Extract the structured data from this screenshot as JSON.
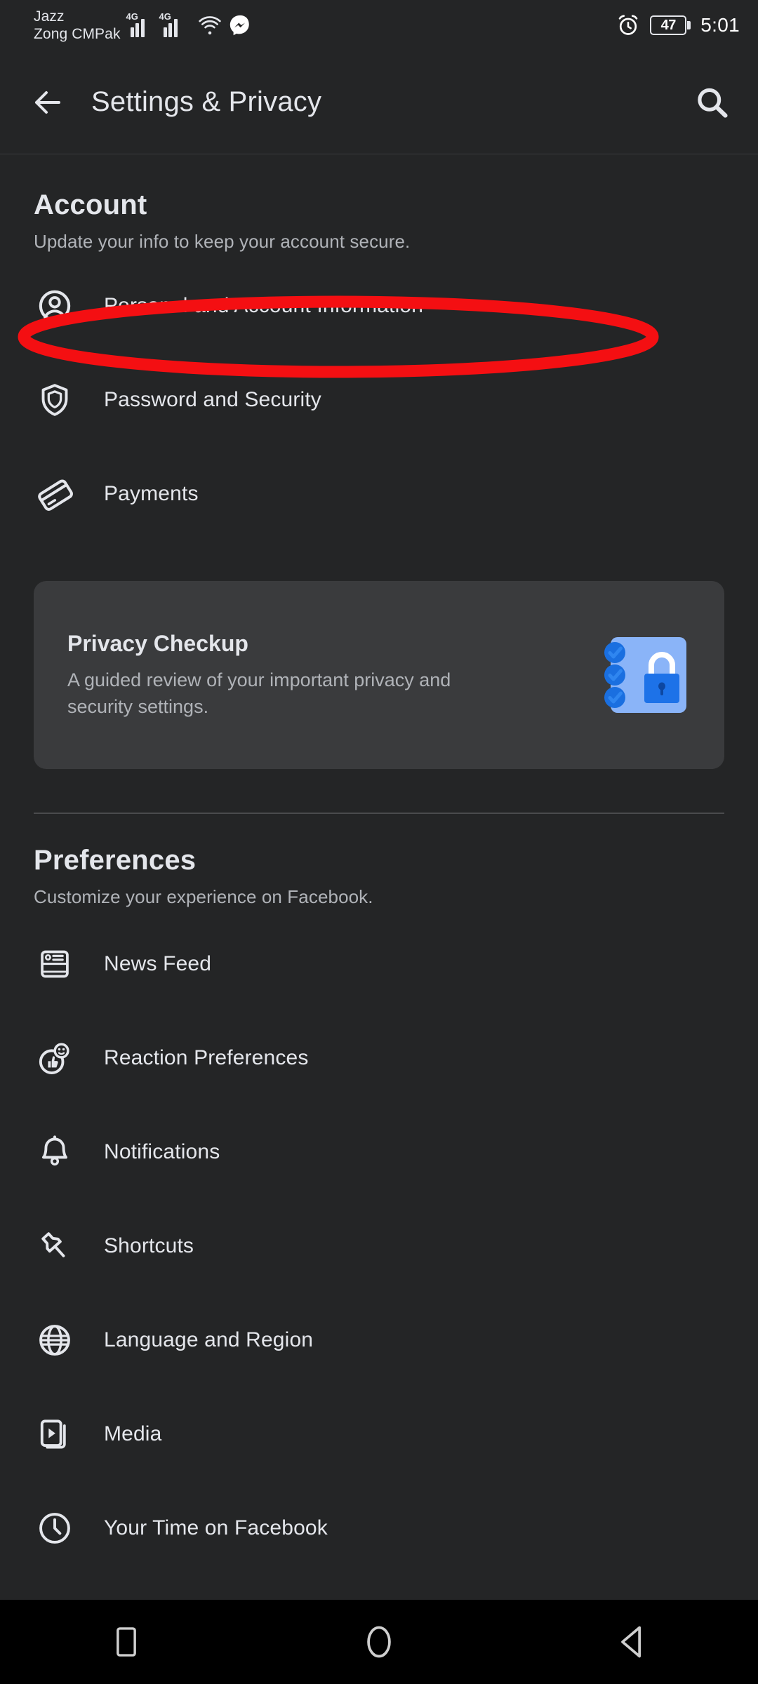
{
  "status_bar": {
    "carrier_line1": "Jazz",
    "carrier_line2": "Zong CMPak",
    "network_1": "4G",
    "network_2": "4G",
    "wifi_icon": "wifi-icon",
    "messenger_icon": "messenger-icon",
    "alarm_icon": "alarm-clock-icon",
    "battery_percent": "47",
    "time": "5:01"
  },
  "header": {
    "back_icon": "back-arrow-icon",
    "title": "Settings & Privacy",
    "search_icon": "search-icon"
  },
  "account": {
    "title": "Account",
    "subtitle": "Update your info to keep your account secure.",
    "items": [
      {
        "label": "Personal and Account Information",
        "icon": "person-circle-icon",
        "highlighted": true
      },
      {
        "label": "Password and Security",
        "icon": "shield-icon",
        "highlighted": false
      },
      {
        "label": "Payments",
        "icon": "credit-card-icon",
        "highlighted": false
      }
    ]
  },
  "privacy_checkup": {
    "title": "Privacy Checkup",
    "description": "A guided review of your important privacy and security settings.",
    "art_icon": "padlock-checklist-illustration",
    "colors": {
      "art_background": "#8ab4f8",
      "lock_body": "#1d72e8",
      "check_circle": "#1a6fe0",
      "card_background": "#3a3b3d"
    }
  },
  "preferences": {
    "title": "Preferences",
    "subtitle": "Customize your experience on Facebook.",
    "items": [
      {
        "label": "News Feed",
        "icon": "news-feed-icon"
      },
      {
        "label": "Reaction Preferences",
        "icon": "reaction-thumbsup-icon"
      },
      {
        "label": "Notifications",
        "icon": "bell-icon"
      },
      {
        "label": "Shortcuts",
        "icon": "pushpin-icon"
      },
      {
        "label": "Language and Region",
        "icon": "globe-icon"
      },
      {
        "label": "Media",
        "icon": "media-play-icon"
      },
      {
        "label": "Your Time on Facebook",
        "icon": "clock-icon"
      }
    ]
  },
  "annotation": {
    "shape": "ellipse",
    "color": "#f40f12",
    "target": "Personal and Account Information"
  },
  "nav_bar": {
    "recents_icon": "square-recents-icon",
    "home_icon": "circle-home-icon",
    "back_icon": "triangle-back-icon"
  },
  "colors": {
    "page_background": "#242526",
    "text_primary": "#e4e6eb",
    "text_secondary": "#b0b3b8",
    "nav_background": "#000000"
  }
}
